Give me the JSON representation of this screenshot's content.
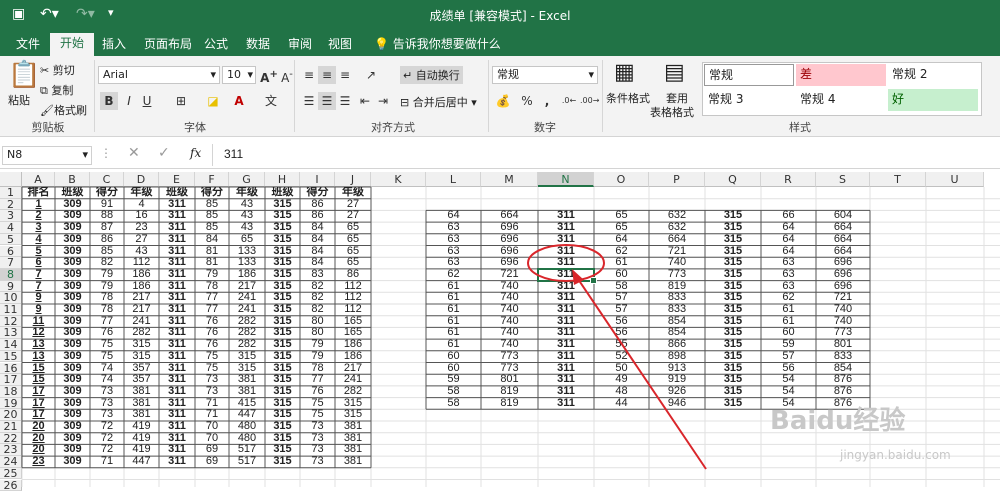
{
  "window": {
    "title": "成绩单 [兼容模式] - Excel"
  },
  "ribbon_tabs": [
    "文件",
    "开始",
    "插入",
    "页面布局",
    "公式",
    "数据",
    "审阅",
    "视图"
  ],
  "tell_me": "告诉我你想要做什么",
  "clipboard": {
    "paste": "粘贴",
    "cut": "剪切",
    "copy": "复制",
    "format_painter": "格式刷",
    "label": "剪贴板"
  },
  "font": {
    "name": "Arial",
    "size": "10",
    "label": "字体"
  },
  "alignment": {
    "wrap": "自动换行",
    "merge": "合并后居中",
    "label": "对齐方式"
  },
  "number": {
    "format": "常规",
    "label": "数字"
  },
  "styles": {
    "conditional": "条件格式",
    "table_line1": "套用",
    "table_line2": "表格格式",
    "label": "样式",
    "cells": [
      "常规",
      "差",
      "常规 2",
      "常规 3",
      "常规 4",
      "好"
    ],
    "bad_color": "#ffc7ce",
    "good_color": "#c6efce"
  },
  "formula_bar": {
    "name_box": "N8",
    "fx": "fx",
    "value": "311"
  },
  "columns": [
    "A",
    "B",
    "C",
    "D",
    "E",
    "F",
    "G",
    "H",
    "I",
    "J",
    "K",
    "L",
    "M",
    "N",
    "O",
    "P",
    "Q",
    "R",
    "S",
    "T",
    "U"
  ],
  "selected_cell": "N8",
  "left_table": {
    "header": [
      "排名",
      "班级",
      "得分",
      "年级",
      "班级",
      "得分",
      "年级",
      "班级",
      "得分",
      "年级"
    ],
    "rows": [
      [
        "1",
        "309",
        "91",
        "4",
        "311",
        "85",
        "43",
        "315",
        "86",
        "27"
      ],
      [
        "2",
        "309",
        "88",
        "16",
        "311",
        "85",
        "43",
        "315",
        "86",
        "27"
      ],
      [
        "3",
        "309",
        "87",
        "23",
        "311",
        "85",
        "43",
        "315",
        "84",
        "65"
      ],
      [
        "4",
        "309",
        "86",
        "27",
        "311",
        "84",
        "65",
        "315",
        "84",
        "65"
      ],
      [
        "5",
        "309",
        "85",
        "43",
        "311",
        "81",
        "133",
        "315",
        "84",
        "65"
      ],
      [
        "6",
        "309",
        "82",
        "112",
        "311",
        "81",
        "133",
        "315",
        "84",
        "65"
      ],
      [
        "7",
        "309",
        "79",
        "186",
        "311",
        "79",
        "186",
        "315",
        "83",
        "86"
      ],
      [
        "7",
        "309",
        "79",
        "186",
        "311",
        "78",
        "217",
        "315",
        "82",
        "112"
      ],
      [
        "9",
        "309",
        "78",
        "217",
        "311",
        "77",
        "241",
        "315",
        "82",
        "112"
      ],
      [
        "9",
        "309",
        "78",
        "217",
        "311",
        "77",
        "241",
        "315",
        "82",
        "112"
      ],
      [
        "11",
        "309",
        "77",
        "241",
        "311",
        "76",
        "282",
        "315",
        "80",
        "165"
      ],
      [
        "12",
        "309",
        "76",
        "282",
        "311",
        "76",
        "282",
        "315",
        "80",
        "165"
      ],
      [
        "13",
        "309",
        "75",
        "315",
        "311",
        "76",
        "282",
        "315",
        "79",
        "186"
      ],
      [
        "13",
        "309",
        "75",
        "315",
        "311",
        "75",
        "315",
        "315",
        "79",
        "186"
      ],
      [
        "15",
        "309",
        "74",
        "357",
        "311",
        "75",
        "315",
        "315",
        "78",
        "217"
      ],
      [
        "15",
        "309",
        "74",
        "357",
        "311",
        "73",
        "381",
        "315",
        "77",
        "241"
      ],
      [
        "17",
        "309",
        "73",
        "381",
        "311",
        "73",
        "381",
        "315",
        "76",
        "282"
      ],
      [
        "17",
        "309",
        "73",
        "381",
        "311",
        "71",
        "415",
        "315",
        "75",
        "315"
      ],
      [
        "17",
        "309",
        "73",
        "381",
        "311",
        "71",
        "447",
        "315",
        "75",
        "315"
      ],
      [
        "20",
        "309",
        "72",
        "419",
        "311",
        "70",
        "480",
        "315",
        "73",
        "381"
      ],
      [
        "20",
        "309",
        "72",
        "419",
        "311",
        "70",
        "480",
        "315",
        "73",
        "381"
      ],
      [
        "20",
        "309",
        "72",
        "419",
        "311",
        "69",
        "517",
        "315",
        "73",
        "381"
      ],
      [
        "23",
        "309",
        "71",
        "447",
        "311",
        "69",
        "517",
        "315",
        "73",
        "381"
      ]
    ]
  },
  "right_table": {
    "rows": [
      [
        "64",
        "664",
        "311",
        "65",
        "632",
        "315",
        "66",
        "604"
      ],
      [
        "63",
        "696",
        "311",
        "65",
        "632",
        "315",
        "64",
        "664"
      ],
      [
        "63",
        "696",
        "311",
        "64",
        "664",
        "315",
        "64",
        "664"
      ],
      [
        "63",
        "696",
        "311",
        "62",
        "721",
        "315",
        "64",
        "664"
      ],
      [
        "63",
        "696",
        "311",
        "61",
        "740",
        "315",
        "63",
        "696"
      ],
      [
        "62",
        "721",
        "311",
        "60",
        "773",
        "315",
        "63",
        "696"
      ],
      [
        "61",
        "740",
        "311",
        "58",
        "819",
        "315",
        "63",
        "696"
      ],
      [
        "61",
        "740",
        "311",
        "57",
        "833",
        "315",
        "62",
        "721"
      ],
      [
        "61",
        "740",
        "311",
        "57",
        "833",
        "315",
        "61",
        "740"
      ],
      [
        "61",
        "740",
        "311",
        "56",
        "854",
        "315",
        "61",
        "740"
      ],
      [
        "61",
        "740",
        "311",
        "56",
        "854",
        "315",
        "60",
        "773"
      ],
      [
        "61",
        "740",
        "311",
        "55",
        "866",
        "315",
        "59",
        "801"
      ],
      [
        "60",
        "773",
        "311",
        "52",
        "898",
        "315",
        "57",
        "833"
      ],
      [
        "60",
        "773",
        "311",
        "50",
        "913",
        "315",
        "56",
        "854"
      ],
      [
        "59",
        "801",
        "311",
        "49",
        "919",
        "315",
        "54",
        "876"
      ],
      [
        "58",
        "819",
        "311",
        "48",
        "926",
        "315",
        "54",
        "876"
      ],
      [
        "58",
        "819",
        "311",
        "44",
        "946",
        "315",
        "54",
        "876"
      ]
    ]
  },
  "annotation": {
    "color": "#d9262b"
  },
  "watermark": {
    "logo": "Baidu经验",
    "url": "jingyan.baidu.com"
  }
}
